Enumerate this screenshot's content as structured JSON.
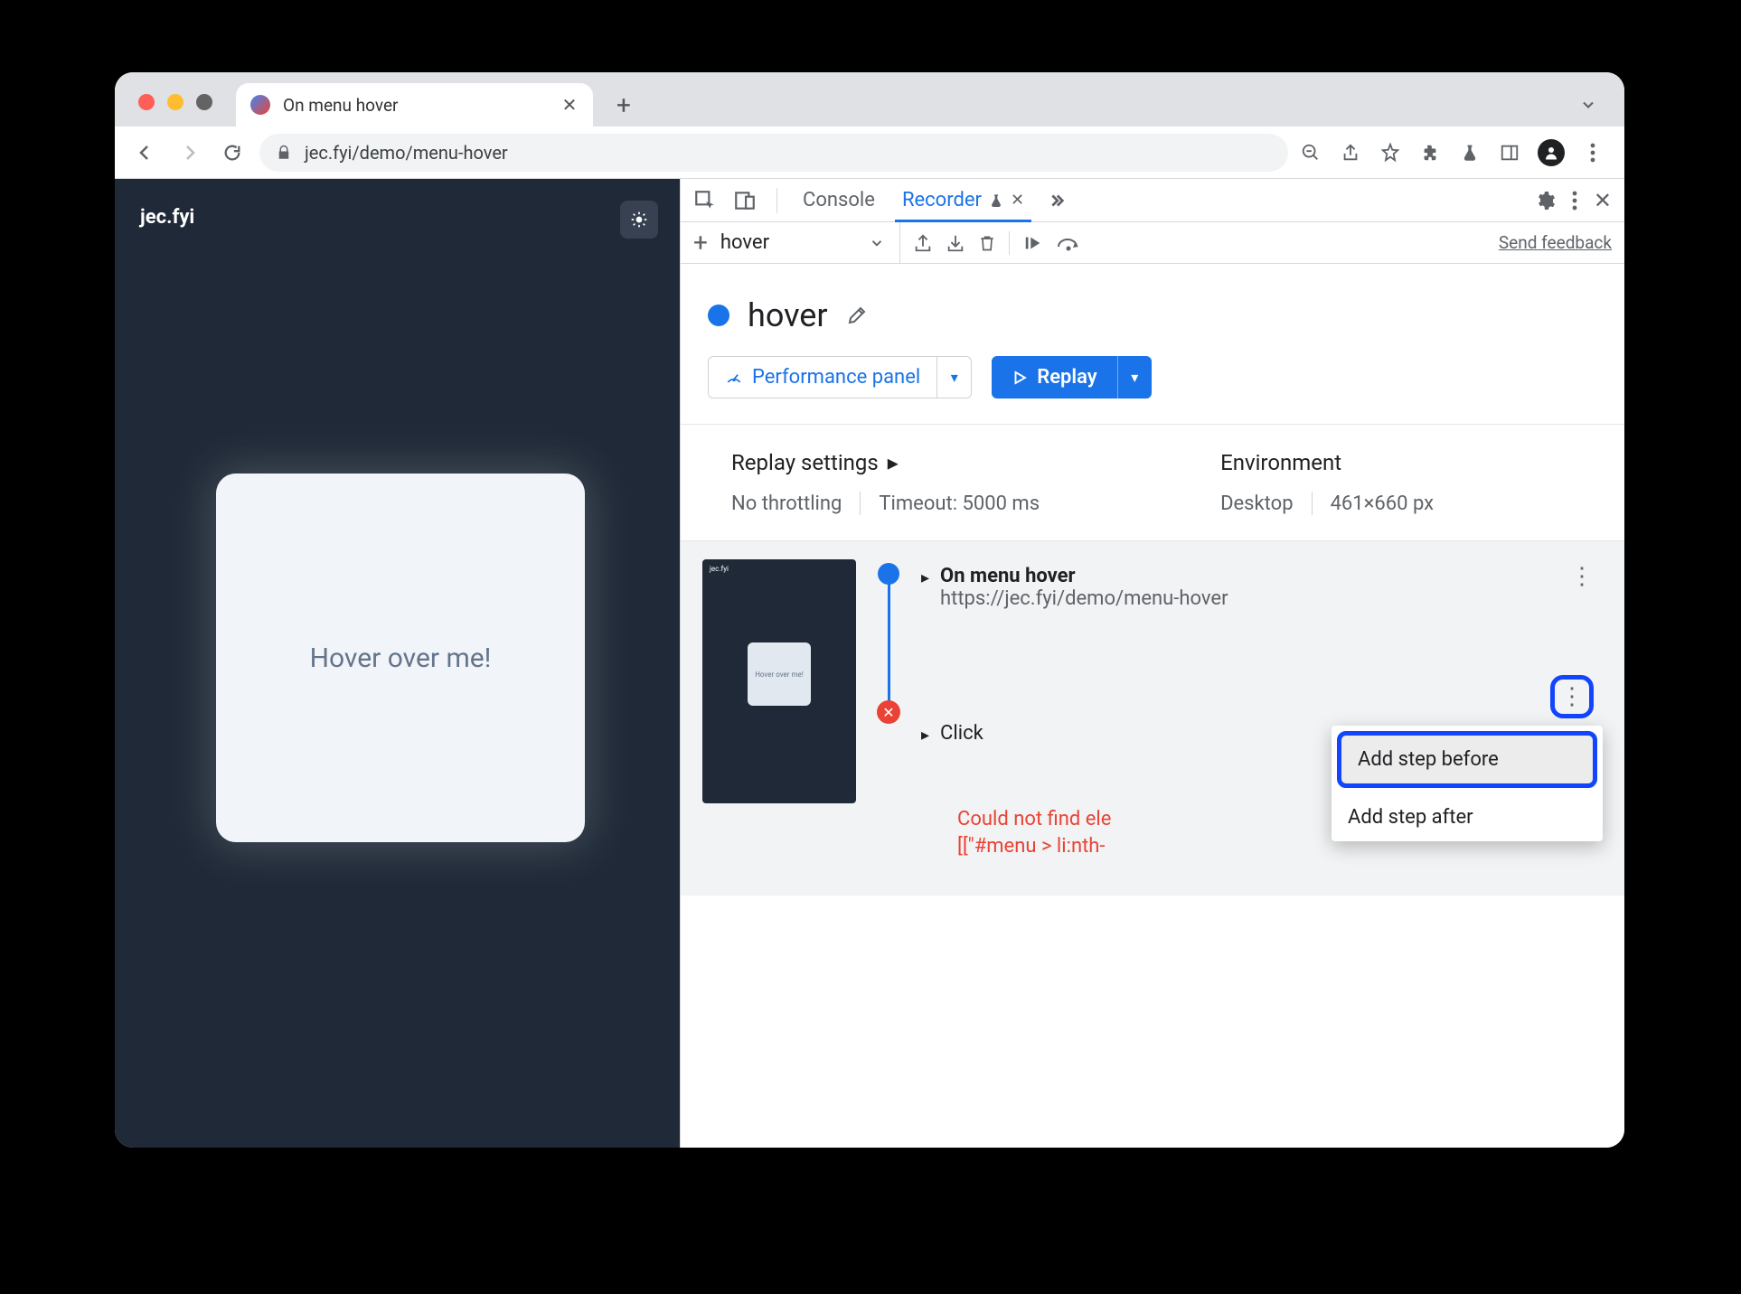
{
  "browser": {
    "tab_title": "On menu hover",
    "url": "jec.fyi/demo/menu-hover"
  },
  "page": {
    "brand": "jec.fyi",
    "card_text": "Hover over me!"
  },
  "devtools": {
    "tabs": {
      "console": "Console",
      "recorder": "Recorder"
    },
    "toolbar": {
      "recording_select": "hover",
      "feedback": "Send feedback"
    },
    "recording": {
      "name": "hover",
      "perf_button": "Performance panel",
      "replay_button": "Replay",
      "settings_hdr": "Replay settings",
      "throttling": "No throttling",
      "timeout": "Timeout: 5000 ms",
      "env_hdr": "Environment",
      "env_device": "Desktop",
      "env_size": "461×660 px"
    },
    "steps": {
      "s1_title": "On menu hover",
      "s1_url": "https://jec.fyi/demo/menu-hover",
      "s2_title": "Click",
      "error_l1": "Could not find ele",
      "error_l2": "[[\"#menu > li:nth-",
      "thumb_text": "Hover over me!",
      "thumb_brand": "jec.fyi"
    },
    "menu": {
      "before": "Add step before",
      "after": "Add step after"
    }
  }
}
